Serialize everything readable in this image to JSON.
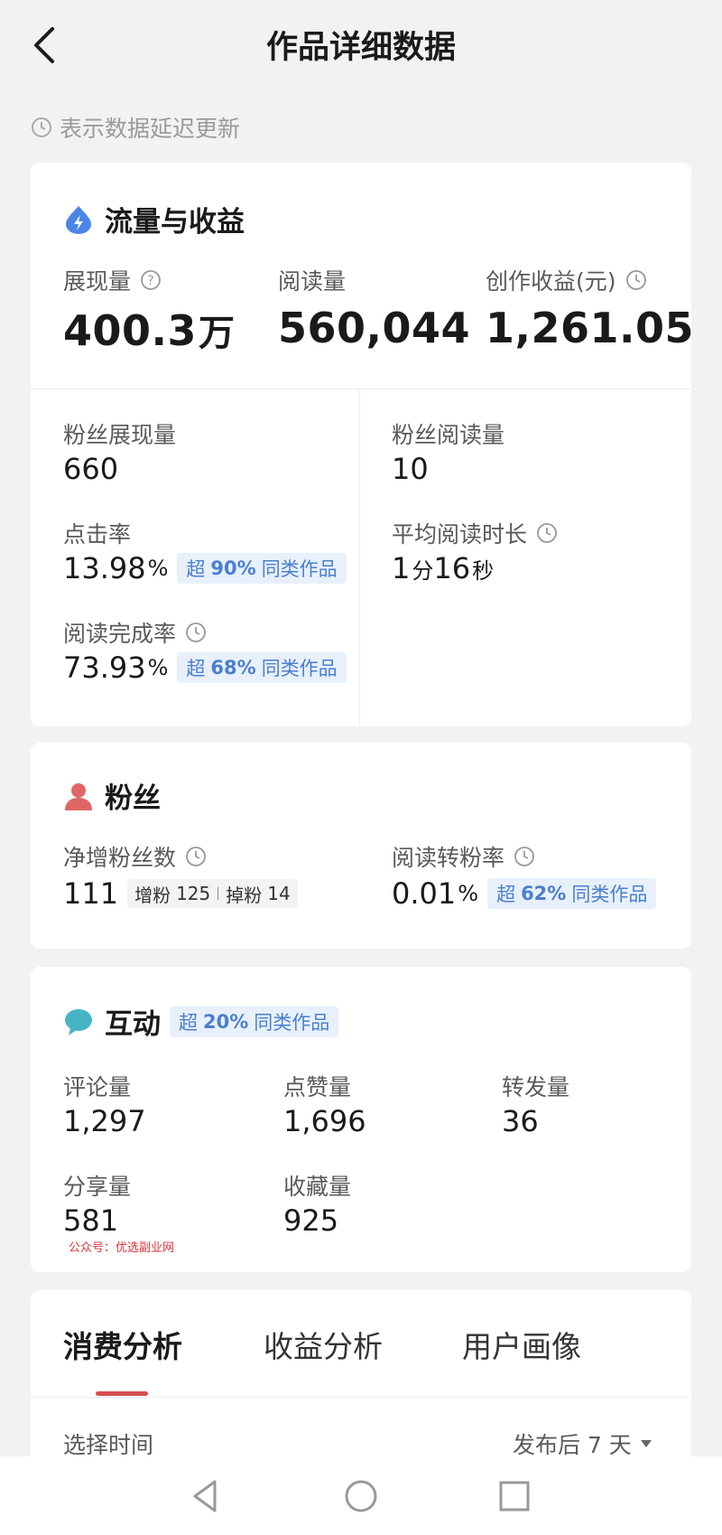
{
  "header": {
    "title": "作品详细数据"
  },
  "delay_note": "表示数据延迟更新",
  "traffic": {
    "title": "流量与收益",
    "impressions": {
      "label": "展现量",
      "value": "400.3",
      "unit": "万"
    },
    "reads": {
      "label": "阅读量",
      "value": "560,044"
    },
    "earnings": {
      "label": "创作收益(元)",
      "value": "1,261.05"
    },
    "fan_impressions": {
      "label": "粉丝展现量",
      "value": "660"
    },
    "fan_reads": {
      "label": "粉丝阅读量",
      "value": "10"
    },
    "ctr": {
      "label": "点击率",
      "value": "13.98",
      "unit": "%",
      "badge": {
        "prefix": "超",
        "pct": "90%",
        "suffix": "同类作品"
      }
    },
    "avg_read_time": {
      "label": "平均阅读时长",
      "min": "1",
      "min_unit": "分",
      "sec": "16",
      "sec_unit": "秒"
    },
    "completion": {
      "label": "阅读完成率",
      "value": "73.93",
      "unit": "%",
      "badge": {
        "prefix": "超",
        "pct": "68%",
        "suffix": "同类作品"
      }
    }
  },
  "fans": {
    "title": "粉丝",
    "net_gain": {
      "label": "净增粉丝数",
      "value": "111",
      "gain_label": "增粉",
      "gain": "125",
      "loss_label": "掉粉",
      "loss": "14"
    },
    "conversion": {
      "label": "阅读转粉率",
      "value": "0.01",
      "unit": "%",
      "badge": {
        "prefix": "超",
        "pct": "62%",
        "suffix": "同类作品"
      }
    }
  },
  "interaction": {
    "title": "互动",
    "badge": {
      "prefix": "超",
      "pct": "20%",
      "suffix": "同类作品"
    },
    "comments": {
      "label": "评论量",
      "value": "1,297"
    },
    "likes": {
      "label": "点赞量",
      "value": "1,696"
    },
    "reposts": {
      "label": "转发量",
      "value": "36"
    },
    "shares": {
      "label": "分享量",
      "value": "581"
    },
    "favorites": {
      "label": "收藏量",
      "value": "925"
    }
  },
  "watermark": "公众号：优选副业网",
  "analysis": {
    "tabs": [
      {
        "label": "消费分析",
        "active": true
      },
      {
        "label": "收益分析",
        "active": false
      },
      {
        "label": "用户画像",
        "active": false
      }
    ],
    "time_label": "选择时间",
    "time_value": "发布后 7 天"
  },
  "colors": {
    "accent_red": "#d64f4f",
    "badge_blue": "#4a7fcf",
    "badge_bg": "#e8f0fb",
    "traffic_icon": "#4a86e8",
    "fans_icon": "#e06666",
    "interaction_icon": "#45b5c4"
  }
}
